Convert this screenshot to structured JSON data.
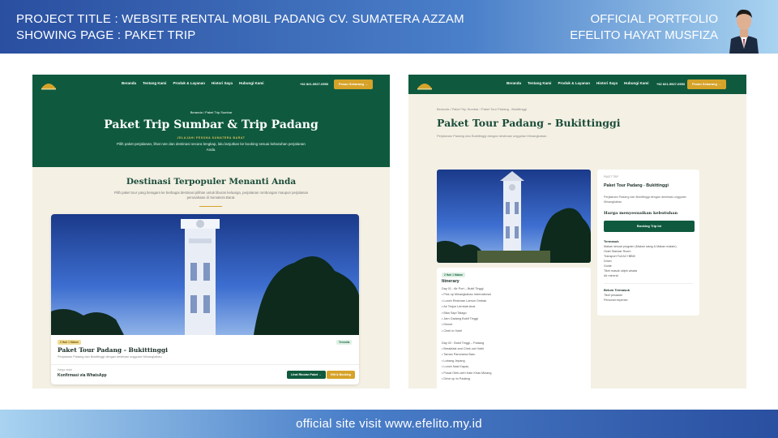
{
  "banner": {
    "project_title": "PROJECT TITLE : WEBSITE RENTAL MOBIL PADANG CV. SUMATERA AZZAM",
    "showing_page": "SHOWING PAGE : PAKET TRIP",
    "portfolio_label": "OFFICIAL PORTFOLIO",
    "author_name": "EFELITO HAYAT MUSFIZA",
    "footer_text": "official site visit www.efelito.my.id"
  },
  "nav": {
    "links": [
      "Beranda",
      "Tentang Kami",
      "Produk & Layanan",
      "Histori Saya",
      "Hubungi Kami"
    ],
    "phone": "+62 821-9527-0953",
    "cta_label": "Pesan Sekarang →"
  },
  "paket_page": {
    "breadcrumb": "Beranda / Paket Trip Sumbar",
    "title": "Paket Trip Sumbar & Trip Padang",
    "kicker": "JELAJAHI PESONA SUMATERA BARAT",
    "description": "Pilih paket perjalanan, lihat rute dan destinasi secara lengkap, lalu lanjutkan ke booking sesuai kebutuhan perjalanan Anda.",
    "section_title": "Destinasi Terpopuler Menanti Anda",
    "section_desc": "Pilih paket tour yang beragam ke berbagai destinasi pilihan untuk liburan keluarga, perjalanan rombongan maupun perjalanan perusahaan di Sumatera Barat.",
    "card": {
      "duration_badge": "2 Hari 1 Malam",
      "status_badge": "Tersedia",
      "title": "Paket Tour Padang - Bukittinggi",
      "description": "Perjalanan Padang dan Bukittinggi dengan destinasi unggulan Minangkabau",
      "mini_label": "Harga mulai",
      "confirm_label": "Konfirmasi via WhatsApp",
      "detail_button": "Lihat Rincian Paket →",
      "booking_button": "Hitt & Booking"
    }
  },
  "detail_page": {
    "breadcrumb": "Beranda / Paket Trip Sumbar / Paket Tour Padang - Bukittinggi",
    "title": "Paket Tour Padang - Bukittinggi",
    "description": "Perjalanan Padang dan Bukittinggi dengan destinasi unggulan Minangkabau",
    "itinerary": {
      "badge": "2 Hari 1 Malam",
      "title": "Itinerary",
      "lines": [
        "Day 01 : Air Port – Bukit Tinggi",
        "• Pick up Minangkabau International",
        "• Lunch Restoran Lamun Ombak",
        "• Air Terjun Lembah Anai",
        "• Bika Sapi Talago",
        "• Jam Gadang Bukit Tinggi",
        "• Dinner",
        "• Chek in Hotel",
        "",
        "Day 02 : Bukit Tinggi – Padang",
        "• Breakfast and Chek out Hotel",
        "• Taman Panorama Baru",
        "• Lobang Jepang",
        "• Lunch Nasi Kapau",
        "• Pusat Oleh-oleh Kain Khas Minang",
        "• Drive up to Padang"
      ]
    },
    "sidebar": {
      "kicker": "PAKET TRIP",
      "title": "Paket Tour Padang - Bukittinggi",
      "description": "Perjalanan Padang dan Bukittinggi dengan destinasi unggulan Minangkabau",
      "price_label": "Harga menyesuaikan kebutuhan",
      "booking_button": "Booking Trip Ini",
      "included_title": "Termasuk",
      "included": [
        "Makan sesuai program (Makan siang & Makan malam)",
        "Hotel Standar Room",
        "Transport Full AC+BBM",
        "Driver",
        "Guide",
        "Tiket masuk objek wisata",
        "Air mineral"
      ],
      "excluded_title": "Belum Termasuk",
      "excluded": [
        "Tiket pesawat",
        "Personal expense"
      ]
    }
  },
  "colors": {
    "brand_green": "#0f5a3e",
    "accent_gold": "#d6a32a",
    "page_cream": "#f4f0e4",
    "banner_blue": "#2a4fa0"
  }
}
